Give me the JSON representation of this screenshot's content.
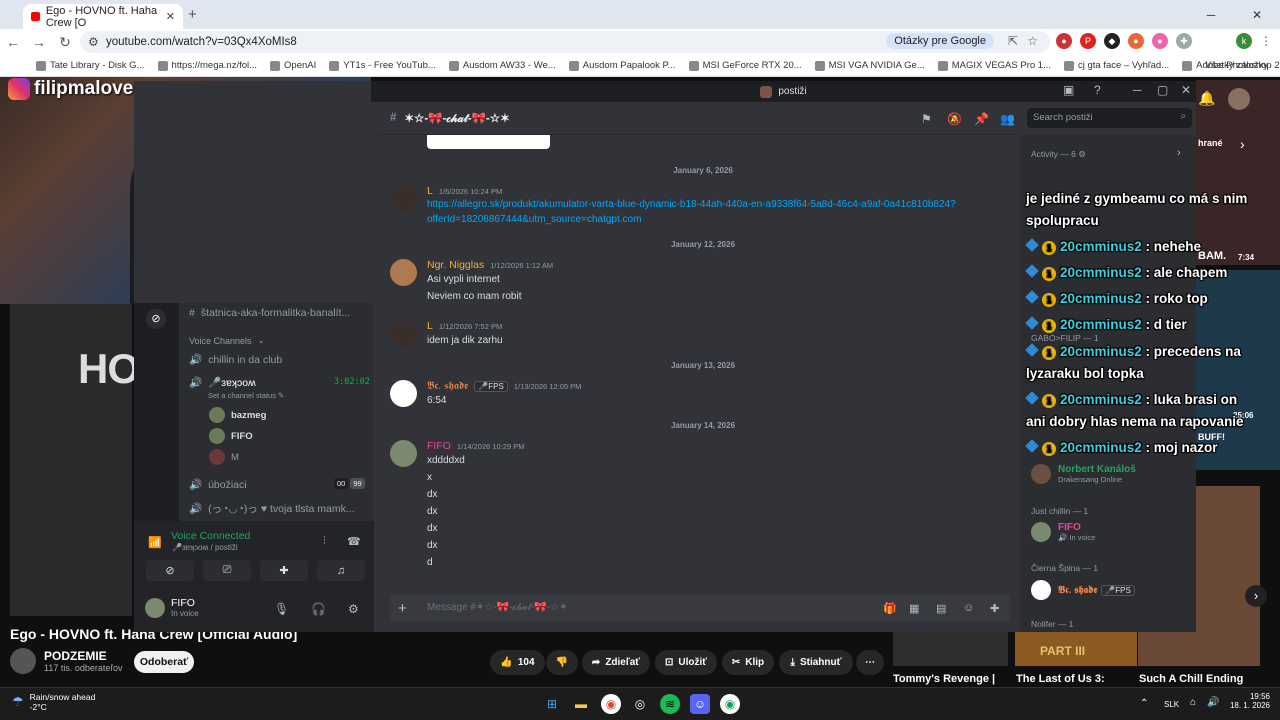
{
  "browser": {
    "tab_title": "Ego - HOVNO ft. Haha Crew [O",
    "url": "youtube.com/watch?v=03Qx4XoMIs8",
    "google_btn": "Otázky pre Google",
    "all_bookmarks": "Všetky záložky",
    "bookmarks": [
      "Tate Library - Disk G...",
      "https://mega.nz/fol...",
      "OpenAI",
      "YT1s - Free YouTub...",
      "Ausdom AW33 - We...",
      "Ausdom Papalook P...",
      "MSI GeForce RTX 20...",
      "MSI VGA NVIDIA Ge...",
      "MAGIX VEGAS Pro 1...",
      "cj gta face – Vyhľad...",
      "Adobe Photoshop 2..."
    ]
  },
  "webcam": {
    "ig_name": "filipmalovec"
  },
  "youtube": {
    "player_text": "HOV",
    "video_title": "Ego - HOVNO ft. Haha Crew [Official Audio]",
    "channel": "PODZEMIE",
    "subs": "117 tis. odberateľov",
    "subscribe": "Odoberať",
    "likes": "104",
    "share": "Zdieľať",
    "save": "Uložiť",
    "clip": "Klip",
    "download": "Stiahnuť",
    "more": "⋯",
    "side_videos": [
      {
        "title": "Tommy's Revenge |"
      },
      {
        "title": "The Last of Us 3:"
      },
      {
        "title": "Such A Chill Ending"
      }
    ],
    "durations": [
      "7:34",
      "25:06"
    ],
    "side_labels": [
      "hrané",
      "BAM.",
      "BUFF!",
      "PART III"
    ]
  },
  "discord": {
    "window_title": "postiži",
    "channel_name": "✶☆-🎀-𝒸𝒽𝒶𝓉-🎀-☆✶",
    "search_placeholder": "Search postiži",
    "channel_top": "štatnica-aka-formalitka-banalít...",
    "voice_cat": "Voice Channels",
    "voice_channels": [
      {
        "name": "chillin in da club"
      },
      {
        "name": "🎤ɜɐʞɔoʍ",
        "timer": "3:02:02",
        "status": "Set a channel status ✎"
      },
      {
        "name": "úbožiaci",
        "count_a": "00",
        "count_b": "99"
      },
      {
        "name": "(っ◔◡◔)っ ♥ tvoja tlsta mamk..."
      }
    ],
    "voice_users": [
      "bazmeg",
      "FIFO",
      "M"
    ],
    "voice_connected": "Voice Connected",
    "voice_sub": "🎤ɜɐʞɔoʍ / postiži",
    "user": {
      "name": "FIFO",
      "status": "In voice"
    },
    "composer_placeholder": "Message #✶☆-🎀-𝒸𝒽𝒶𝓉-🎀-☆✶",
    "dates": [
      "January 6, 2026",
      "January 12, 2026",
      "January 13, 2026",
      "January 14, 2026"
    ],
    "messages": [
      {
        "author": "L",
        "color": "#f0b232",
        "time": "1/6/2026 10:24 PM",
        "lines": [
          "https://allegro.sk/produkt/akumulator-varta-blue-dynamic-b18-44ah-440a-en-a9338f64-5a8d-46c4-a9af-0a41c810b824?",
          "offerId=18208867444&utm_source=chatgpt.com"
        ]
      },
      {
        "author": "Ngr. Nigglas",
        "color": "#f0b232",
        "time": "1/12/2026 1:12 AM",
        "lines": [
          "Asi vypli internet",
          "Neviem co mam robit"
        ]
      },
      {
        "author": "L",
        "color": "#f0b232",
        "time": "1/12/2026 7:52 PM",
        "lines": [
          "idem ja dik zarhu"
        ]
      },
      {
        "author": "𝕭𝖈. 𝖘𝖍𝖆𝖉𝖊",
        "color": "#e8844b",
        "time": "1/13/2026 12:05 PM",
        "badge": "🎤FPS",
        "lines": [
          "6:54"
        ]
      },
      {
        "author": "FIFO",
        "color": "#eb459e",
        "time": "1/14/2026 10:29 PM",
        "lines": [
          "xddddxd",
          "x",
          "dx",
          "dx",
          "dx",
          "dx",
          "d"
        ]
      }
    ],
    "members": {
      "activity": "Activity — 6 ⚙",
      "just_chillin": "Just chillin — 1",
      "cierna": "Čierna Špina — 1",
      "nolifer": "Nolifer — 1",
      "gabo": "GABO>FILIP — 1",
      "list": [
        {
          "name": "Norbert Kanáloš",
          "status": "Drakensang Online",
          "color": "#23a55a"
        },
        {
          "name": "FIFO",
          "status": "🔊 In voice",
          "color": "#eb459e"
        },
        {
          "name": "𝕭𝖈. 𝖘𝖍𝖆𝖉𝖊",
          "status": "🎤FPS",
          "color": "#e8844b"
        }
      ]
    }
  },
  "overlay": [
    {
      "user": "",
      "text": "je jediné z gymbeamu co má s nim"
    },
    {
      "user": "",
      "text": "spolupracu"
    },
    {
      "user": "20cmminus2",
      "text": " : nehehe"
    },
    {
      "user": "20cmminus2",
      "text": " : ale chapem"
    },
    {
      "user": "20cmminus2",
      "text": " : roko top"
    },
    {
      "user": "20cmminus2",
      "text": " : d tier"
    },
    {
      "user": "20cmminus2",
      "text": " : precedens na"
    },
    {
      "user": "",
      "text": "lyzaraku bol topka"
    },
    {
      "user": "20cmminus2",
      "text": " : luka brasi on"
    },
    {
      "user": "",
      "text": "ani dobry hlas nema na rapovanie"
    },
    {
      "user": "20cmminus2",
      "text": " : moj nazor"
    }
  ],
  "taskbar": {
    "weather_title": "Rain/snow ahead",
    "temp": "-2°C",
    "lang": "SLK",
    "time": "19:56",
    "date": "18. 1. 2026"
  },
  "colors": {
    "discord_bg": "#313338",
    "online": "#23a55a",
    "link": "#00a8fc"
  }
}
